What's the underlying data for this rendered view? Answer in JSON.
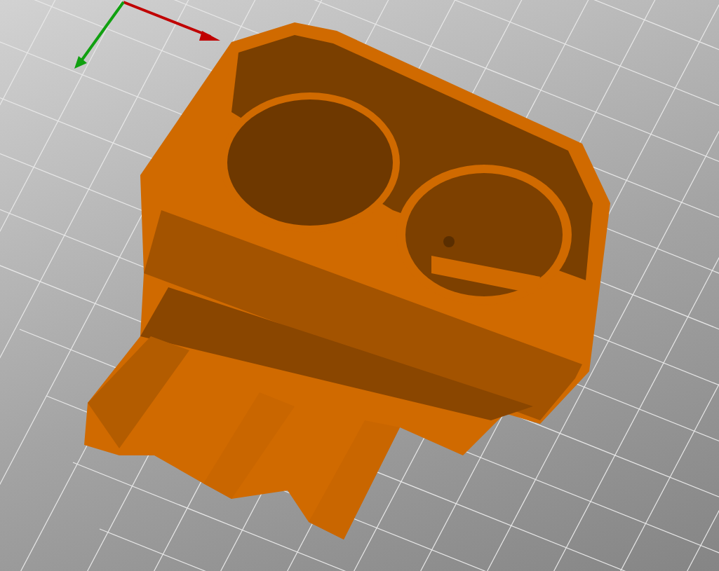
{
  "viewport": {
    "axes": [
      {
        "kind": "x",
        "color": "#c00000"
      },
      {
        "kind": "y",
        "color": "#10a010"
      }
    ]
  }
}
